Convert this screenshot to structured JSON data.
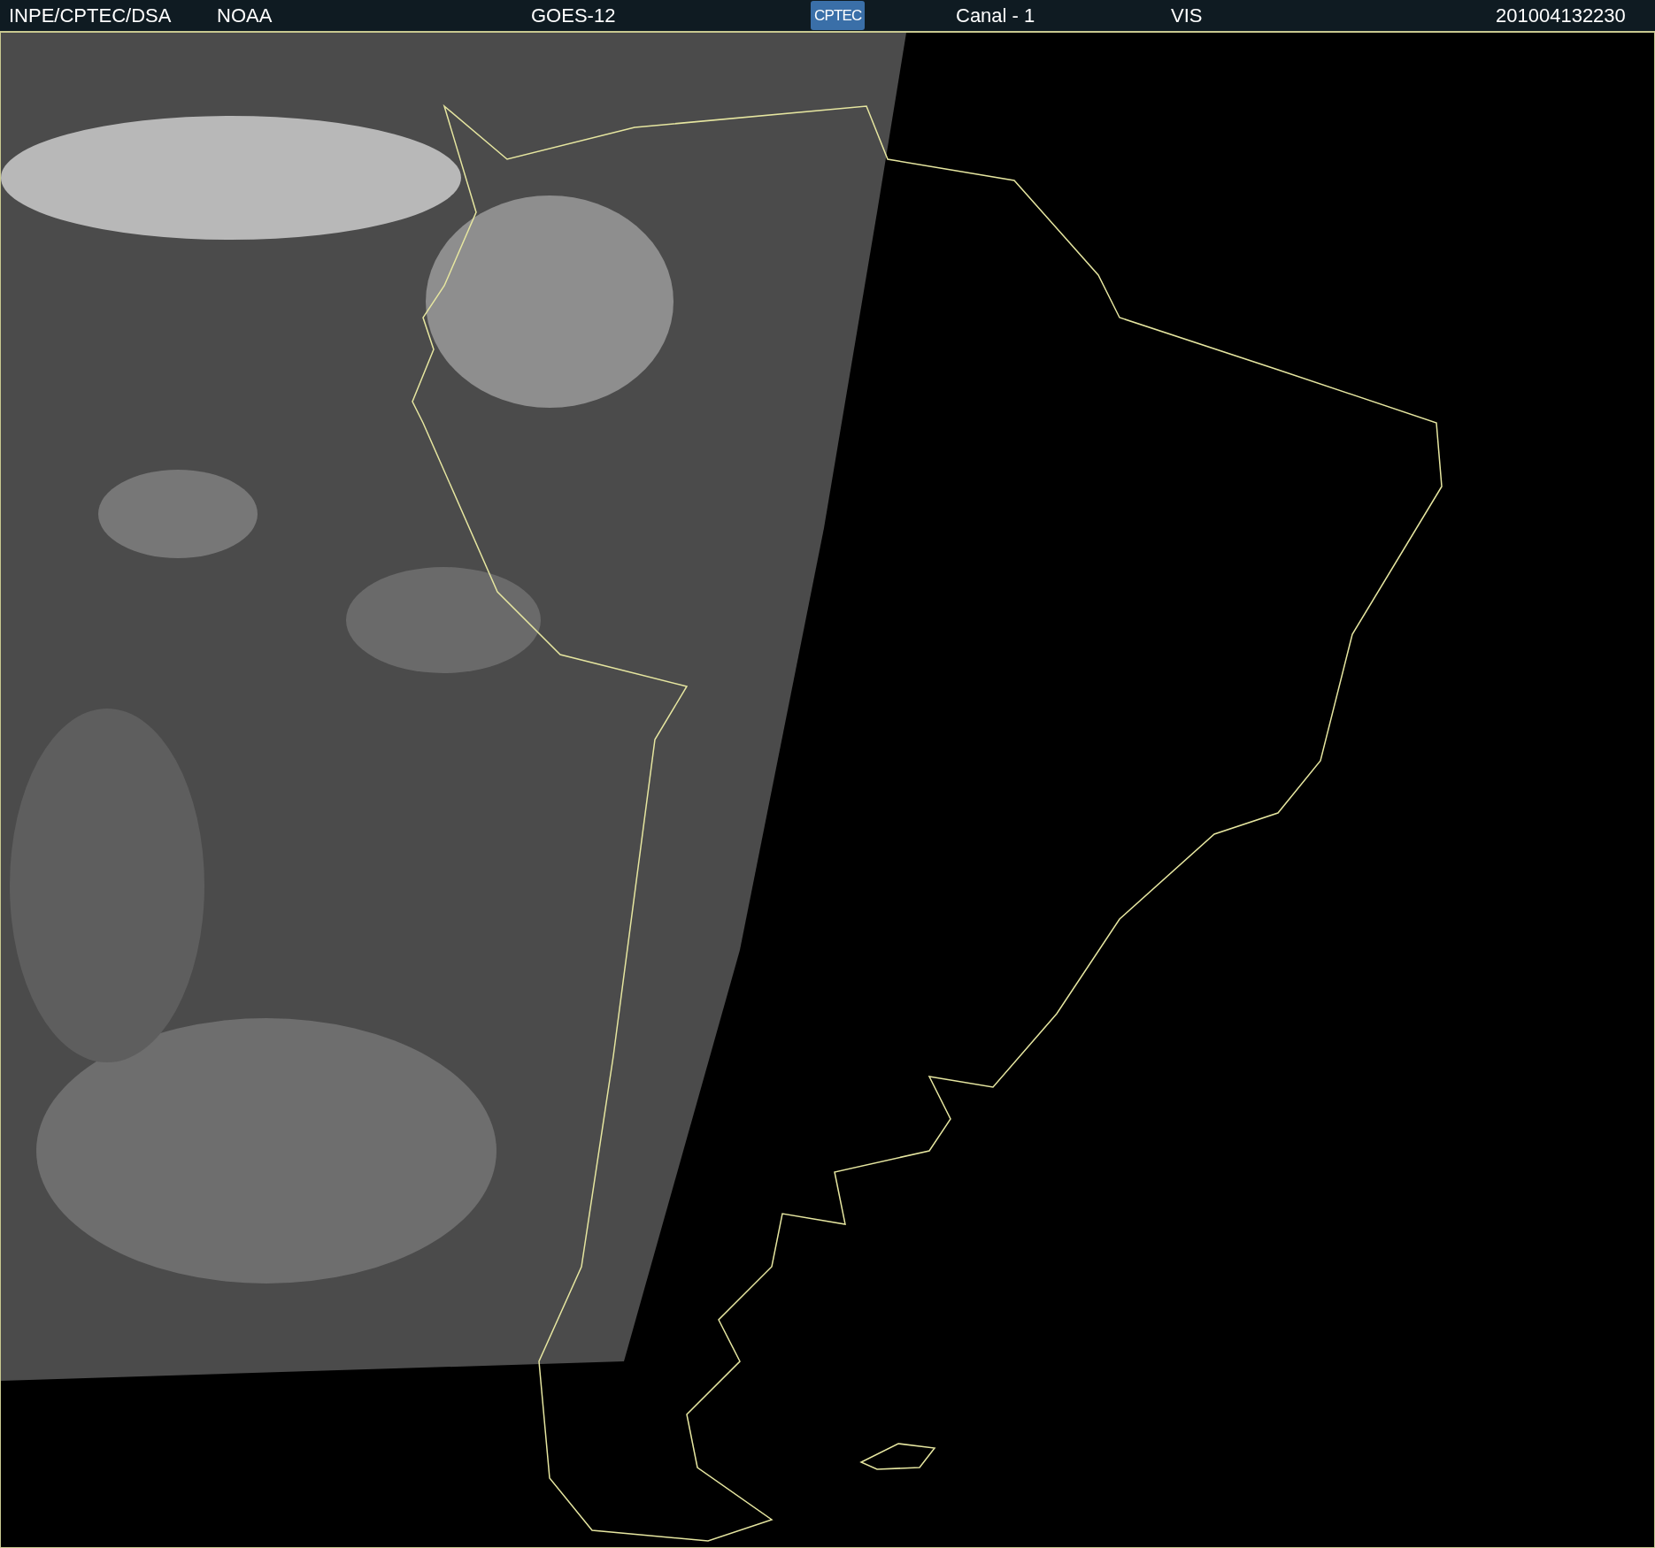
{
  "header": {
    "items": [
      {
        "kind": "text",
        "text": "INPE/CPTEC/DSA"
      },
      {
        "kind": "text",
        "text": "NOAA"
      },
      {
        "kind": "text",
        "text": "GOES-12"
      },
      {
        "kind": "logo",
        "text": "CPTEC"
      },
      {
        "kind": "text",
        "text": "Canal - 1"
      },
      {
        "kind": "text",
        "text": "VIS"
      },
      {
        "kind": "text",
        "text": "201004132230"
      }
    ]
  }
}
